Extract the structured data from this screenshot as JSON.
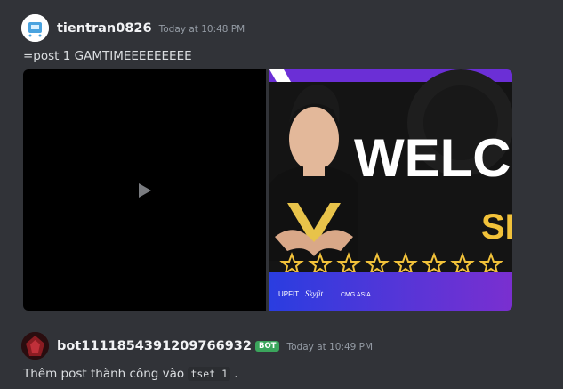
{
  "messages": [
    {
      "username": "tientran0826",
      "timestamp": "Today at 10:48 PM",
      "content": "=post 1 GAMTIMEEEEEEEEE"
    },
    {
      "username": "bot1111854391209766932",
      "badge": "BOT",
      "timestamp": "Today at 10:49 PM",
      "content_prefix": "Thêm post thành công vào",
      "content_code": "tset 1",
      "content_suffix": "."
    }
  ],
  "embed_image": {
    "banner_text": "WELCO",
    "sub_text": "SLA",
    "sponsor_labels": [
      "UPFIT",
      "Skyfit",
      "CMG ASIA"
    ]
  },
  "colors": {
    "background": "#313338",
    "bot_badge": "#3ba55c",
    "banner_purple": "#6b2fd6",
    "banner_blue": "#2a3de0"
  }
}
